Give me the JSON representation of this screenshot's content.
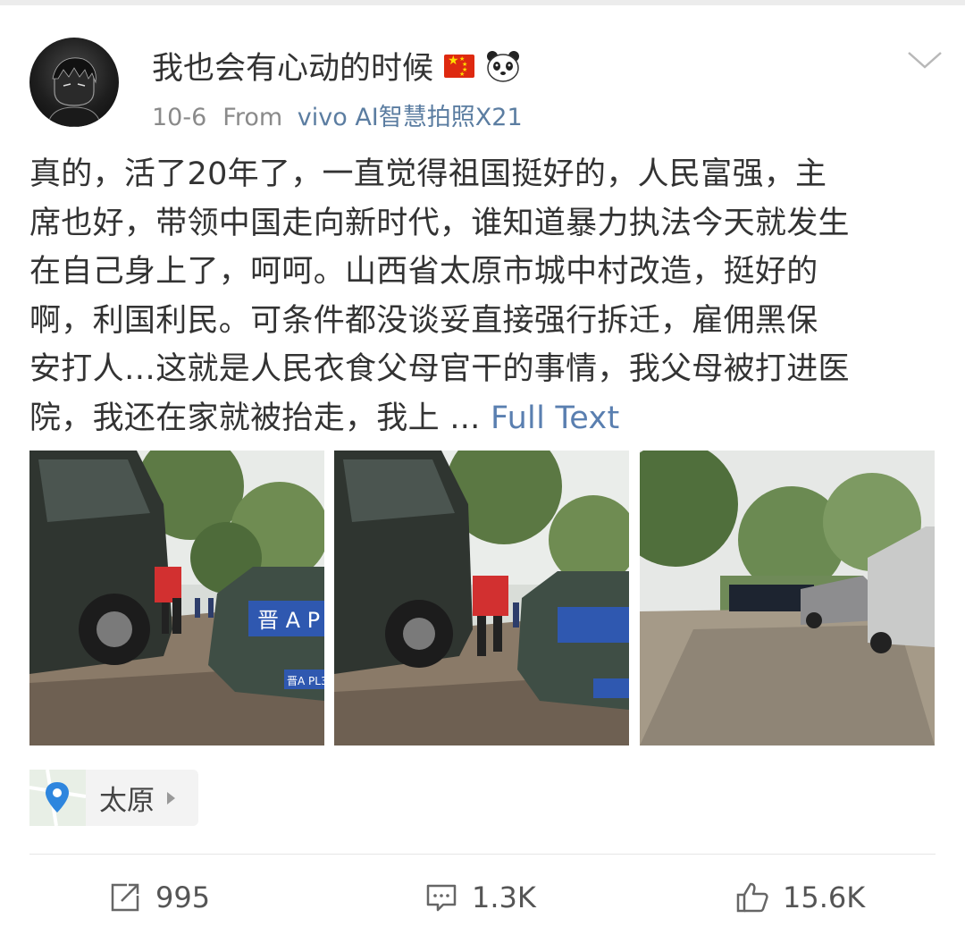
{
  "post": {
    "username": "我也会有心动的时候",
    "date": "10-6",
    "from_label": "From",
    "source": "vivo AI智慧拍照X21",
    "text_lines": [
      "真的，活了20年了，一直觉得祖国挺好的，人民富强，主",
      "席也好，带领中国走向新时代，谁知道暴力执法今天就发生",
      "在自己身上了，呵呵。山西省太原市城中村改造，挺好的",
      "啊，利国利民。可条件都没谈妥直接强行拆迁，雇佣黑保",
      "安打人…这就是人民衣食父母官干的事情，我父母被打进医",
      "院，我还在家就被抬走，我上 ..."
    ],
    "full_text_link": "Full Text",
    "location": "太原",
    "plate_text": "晋 A P",
    "plate_small": "晋A PL3"
  },
  "actions": {
    "repost_count": "995",
    "comment_count": "1.3K",
    "like_count": "15.6K"
  },
  "colors": {
    "link": "#5a7fb0",
    "meta": "#8a8a8a",
    "text": "#333333"
  },
  "icons": [
    "flag-cn-icon",
    "panda-icon",
    "chevron-down-icon",
    "location-pin-icon",
    "repost-icon",
    "comment-icon",
    "like-icon"
  ]
}
